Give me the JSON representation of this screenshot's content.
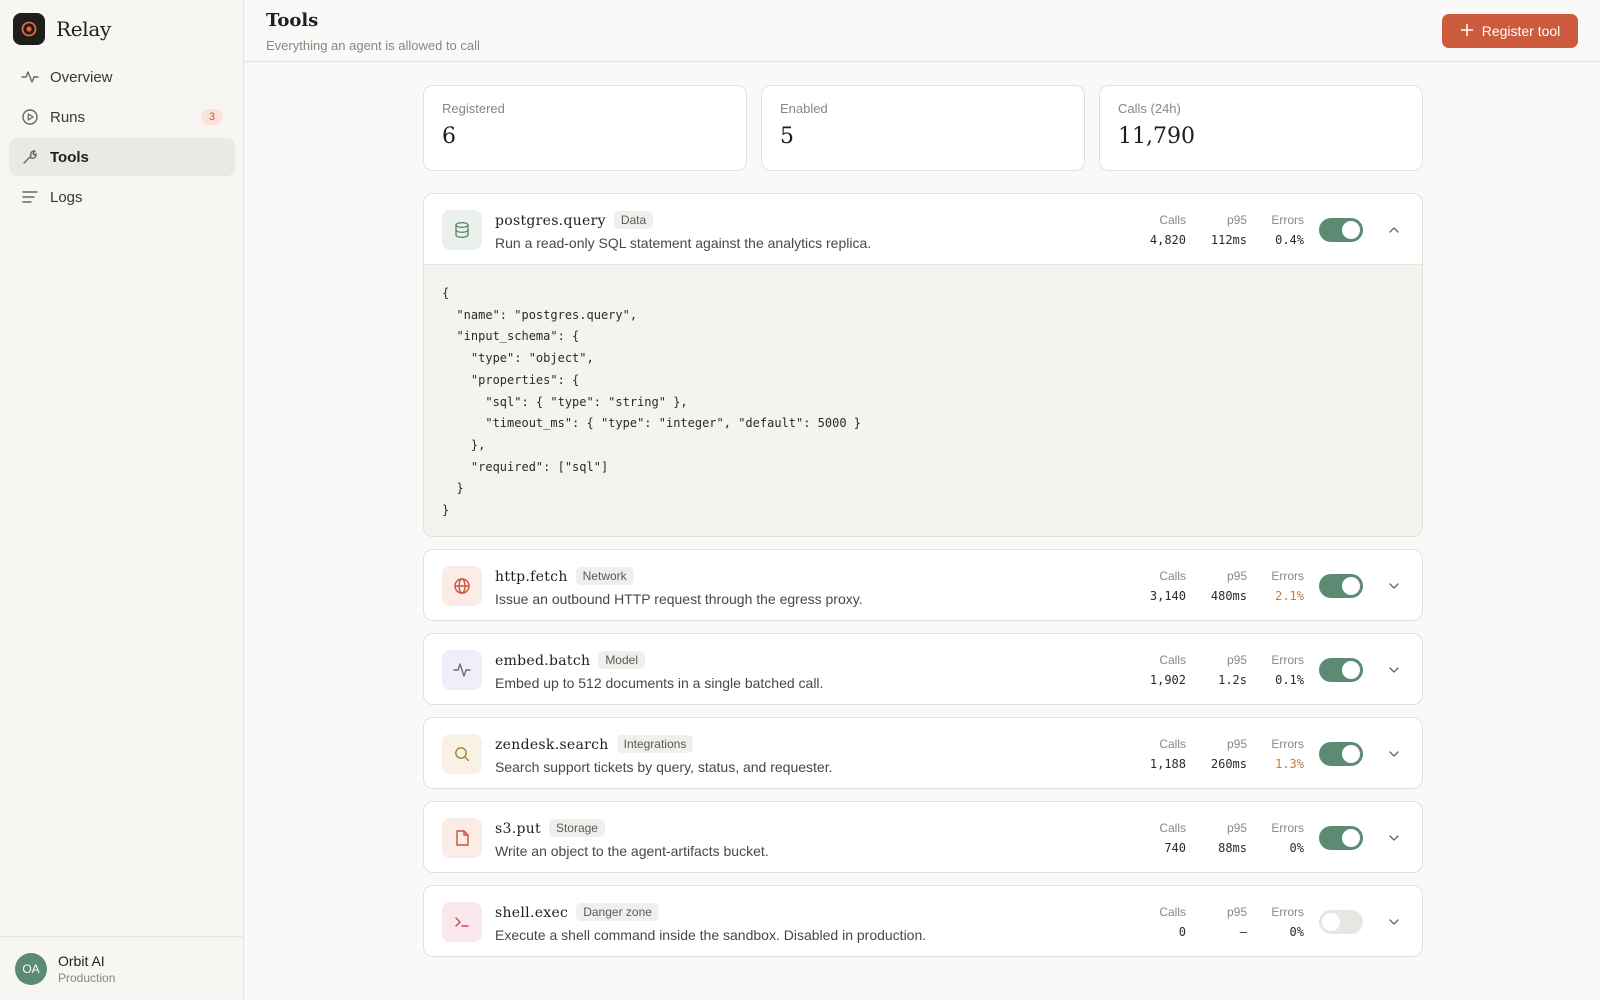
{
  "app": {
    "name": "Relay"
  },
  "sidebar": {
    "items": [
      {
        "label": "Overview",
        "icon": "activity-icon"
      },
      {
        "label": "Runs",
        "icon": "play-circle-icon",
        "badge": "3"
      },
      {
        "label": "Tools",
        "icon": "wrench-icon",
        "active": true
      },
      {
        "label": "Logs",
        "icon": "list-icon"
      }
    ],
    "user": {
      "initials": "OA",
      "name": "Orbit AI",
      "env": "Production"
    }
  },
  "header": {
    "title": "Tools",
    "subtitle": "Everything an agent is allowed to call",
    "register_label": "Register tool"
  },
  "stats": [
    {
      "label": "Registered",
      "value": "6"
    },
    {
      "label": "Enabled",
      "value": "5"
    },
    {
      "label": "Calls (24h)",
      "value": "11,790"
    }
  ],
  "metric_labels": {
    "calls": "Calls",
    "p95": "p95",
    "errors": "Errors"
  },
  "tools": [
    {
      "name": "postgres.query",
      "tag": "Data",
      "description": "Run a read-only SQL statement against the analytics replica.",
      "calls": "4,820",
      "p95": "112ms",
      "errors": "0.4%",
      "enabled": true,
      "expanded": true,
      "icon": "database-icon",
      "schema": "{\n  \"name\": \"postgres.query\",\n  \"input_schema\": {\n    \"type\": \"object\",\n    \"properties\": {\n      \"sql\": { \"type\": \"string\" },\n      \"timeout_ms\": { \"type\": \"integer\", \"default\": 5000 }\n    },\n    \"required\": [\"sql\"]\n  }\n}"
    },
    {
      "name": "http.fetch",
      "tag": "Network",
      "description": "Issue an outbound HTTP request through the egress proxy.",
      "calls": "3,140",
      "p95": "480ms",
      "errors": "2.1%",
      "enabled": true,
      "icon": "globe-icon"
    },
    {
      "name": "embed.batch",
      "tag": "Model",
      "description": "Embed up to 512 documents in a single batched call.",
      "calls": "1,902",
      "p95": "1.2s",
      "errors": "0.1%",
      "enabled": true,
      "icon": "pulse-icon"
    },
    {
      "name": "zendesk.search",
      "tag": "Integrations",
      "description": "Search support tickets by query, status, and requester.",
      "calls": "1,188",
      "p95": "260ms",
      "errors": "1.3%",
      "enabled": true,
      "icon": "search-icon"
    },
    {
      "name": "s3.put",
      "tag": "Storage",
      "description": "Write an object to the agent-artifacts bucket.",
      "calls": "740",
      "p95": "88ms",
      "errors": "0%",
      "enabled": true,
      "icon": "file-icon"
    },
    {
      "name": "shell.exec",
      "tag": "Danger zone",
      "description": "Execute a shell command inside the sandbox. Disabled in production.",
      "calls": "0",
      "p95": "—",
      "errors": "0%",
      "enabled": false,
      "icon": "terminal-icon"
    }
  ],
  "colors": {
    "accent": "#cc5a3c",
    "toggle_on": "#5c8a72",
    "warn": "#c97a3a"
  }
}
